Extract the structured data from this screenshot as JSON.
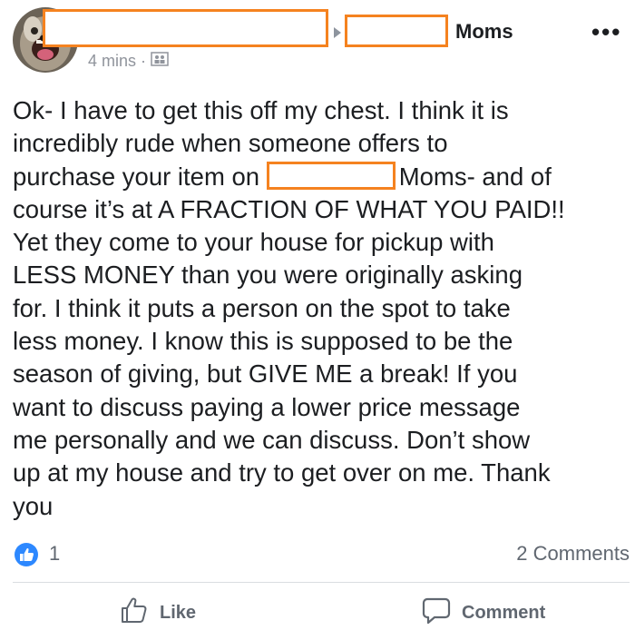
{
  "post": {
    "group_name": "Moms",
    "more_label": "•••",
    "timestamp": "4 mins",
    "separator": "·",
    "privacy_icon": "group-audience-icon",
    "text_before": "Ok- I have to get this off my chest. I think it is\nincredibly rude when someone offers to\npurchase your item on ",
    "text_after": "Moms- and of\ncourse it’s at A FRACTION OF WHAT YOU PAID!!\nYet they come to your house for pickup with\nLESS MONEY than you were originally asking\nfor. I think it puts a person on the spot to take\nless money. I know this is supposed to be the\nseason of giving, but GIVE ME a break! If you\nwant to discuss paying a lower price message\nme personally and we can discuss. Don’t show\nup at my house and try to get over on me. Thank\nyou",
    "like_count": "1",
    "comment_count": "2 Comments"
  },
  "actions": {
    "like_label": "Like",
    "comment_label": "Comment"
  },
  "colors": {
    "redaction": "#f5821f",
    "like_blue": "#2d88ff",
    "secondary_text": "#606770"
  }
}
